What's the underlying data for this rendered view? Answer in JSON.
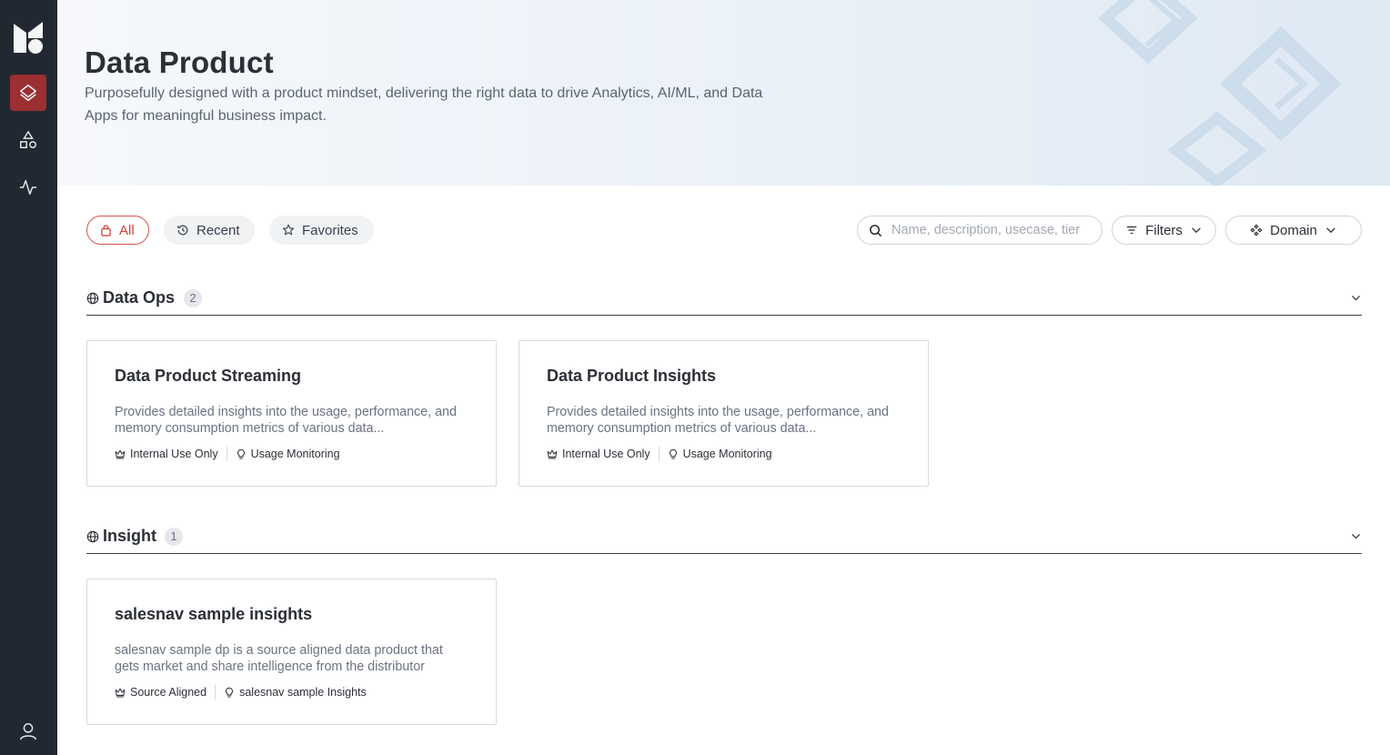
{
  "sidebar": {
    "nav": [
      "data-product",
      "shapes",
      "activity"
    ],
    "active": "data-product"
  },
  "hero": {
    "title": "Data Product",
    "subtitle": "Purposefully designed with a product mindset, delivering the right data to drive Analytics, AI/ML, and Data Apps for meaningful business impact."
  },
  "tabs": {
    "all": "All",
    "recent": "Recent",
    "favorites": "Favorites"
  },
  "search": {
    "placeholder": "Name, description, usecase, tier",
    "value": ""
  },
  "filters_label": "Filters",
  "domain_label": "Domain",
  "sections": [
    {
      "title": "Data Ops",
      "count": "2",
      "cards": [
        {
          "title": "Data Product Streaming",
          "description": "Provides detailed insights into the usage, performance, and memory consumption metrics of various data...",
          "tier": "Internal Use Only",
          "usecase": "Usage Monitoring"
        },
        {
          "title": "Data Product Insights",
          "description": "Provides detailed insights into the usage, performance, and memory consumption metrics of various data...",
          "tier": "Internal Use Only",
          "usecase": "Usage Monitoring"
        }
      ]
    },
    {
      "title": "Insight",
      "count": "1",
      "cards": [
        {
          "title": "salesnav sample insights",
          "description": "salesnav sample dp is a source aligned data product that gets market and share intelligence from the distributor",
          "tier": "Source Aligned",
          "usecase": "salesnav sample Insights"
        }
      ]
    }
  ],
  "colors": {
    "sidebar": "#222831",
    "active_nav": "#9b2f32",
    "accent": "#d9534f"
  }
}
